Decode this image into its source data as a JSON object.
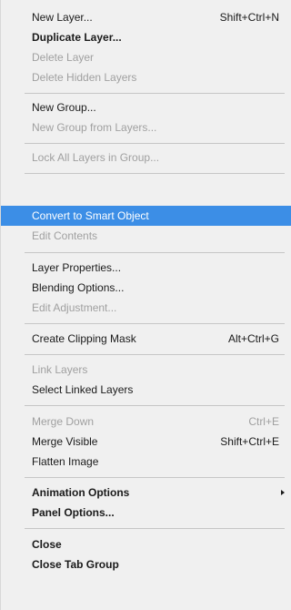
{
  "menu": {
    "new_layer": {
      "label": "New Layer...",
      "shortcut": "Shift+Ctrl+N"
    },
    "duplicate_layer": {
      "label": "Duplicate Layer..."
    },
    "delete_layer": {
      "label": "Delete Layer"
    },
    "delete_hidden_layers": {
      "label": "Delete Hidden Layers"
    },
    "new_group": {
      "label": "New Group..."
    },
    "new_group_from_layers": {
      "label": "New Group from Layers..."
    },
    "lock_all_layers_in_group": {
      "label": "Lock All Layers in Group..."
    },
    "convert_to_smart_object": {
      "label": "Convert to Smart Object"
    },
    "edit_contents": {
      "label": "Edit Contents"
    },
    "layer_properties": {
      "label": "Layer Properties..."
    },
    "blending_options": {
      "label": "Blending Options..."
    },
    "edit_adjustment": {
      "label": "Edit Adjustment..."
    },
    "create_clipping_mask": {
      "label": "Create Clipping Mask",
      "shortcut": "Alt+Ctrl+G"
    },
    "link_layers": {
      "label": "Link Layers"
    },
    "select_linked_layers": {
      "label": "Select Linked Layers"
    },
    "merge_down": {
      "label": "Merge Down",
      "shortcut": "Ctrl+E"
    },
    "merge_visible": {
      "label": "Merge Visible",
      "shortcut": "Shift+Ctrl+E"
    },
    "flatten_image": {
      "label": "Flatten Image"
    },
    "animation_options": {
      "label": "Animation Options"
    },
    "panel_options": {
      "label": "Panel Options..."
    },
    "close": {
      "label": "Close"
    },
    "close_tab_group": {
      "label": "Close Tab Group"
    }
  },
  "colors": {
    "highlight": "#3c8ee6",
    "menu_background": "#f0f0f0",
    "disabled_text": "#a0a0a0"
  },
  "icons": {
    "submenu": "chevron-right-icon"
  }
}
